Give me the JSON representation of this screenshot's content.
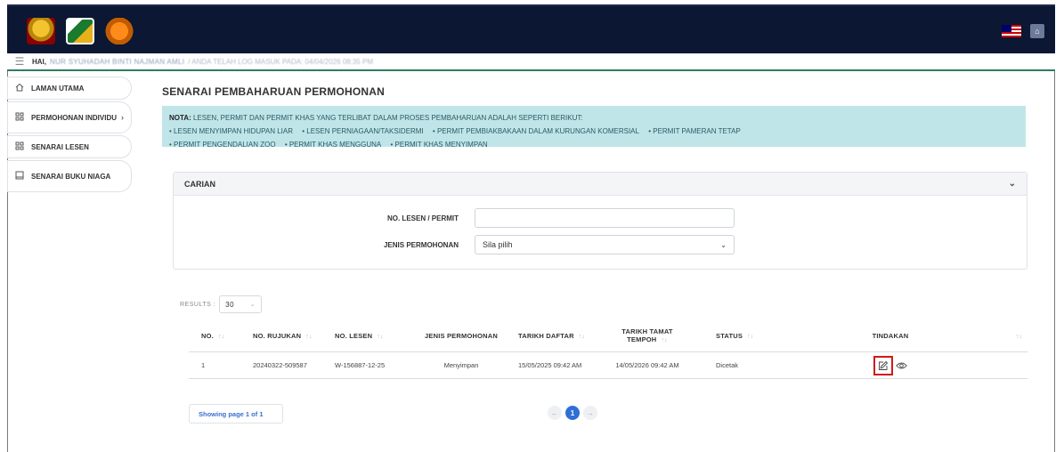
{
  "header": {
    "logos": [
      "crest-logo",
      "perhilitan-logo",
      "tiger-logo"
    ],
    "right_icons": [
      "malaysia-flag-icon",
      "language-icon"
    ]
  },
  "userbar": {
    "greeting": "HAI,",
    "username": "NUR SYUHADAH BINTI NAJMAN AMLI",
    "login_info": "/ ANDA TELAH LOG MASUK PADA: 04/04/2026 08:35 PM"
  },
  "sidebar": {
    "items": [
      {
        "label": "LAMAN UTAMA",
        "icon": "home-icon"
      },
      {
        "label": "PERMOHONAN INDIVIDU",
        "icon": "grid-icon",
        "has_submenu": true
      },
      {
        "label": "SENARAI LESEN",
        "icon": "grid-icon"
      },
      {
        "label": "SENARAI BUKU NIAGA",
        "icon": "book-icon"
      }
    ]
  },
  "main": {
    "title": "SENARAI PEMBAHARUAN PERMOHONAN",
    "note": {
      "prefix": "NOTA:",
      "text": "LESEN, PERMIT DAN PERMIT KHAS YANG TERLIBAT DALAM PROSES PEMBAHARUAN ADALAH SEPERTI BERIKUT:",
      "line1": [
        "LESEN MENYIMPAN HIDUPAN LIAR",
        "LESEN PERNIAGAAN/TAKSIDERMI",
        "PERMIT PEMBIAKBAKAAN DALAM KURUNGAN KOMERSIAL",
        "PERMIT PAMERAN TETAP"
      ],
      "line2": [
        "PERMIT PENGENDALIAN ZOO",
        "PERMIT KHAS MENGGUNA",
        "PERMIT KHAS MENYIMPAN"
      ]
    },
    "search": {
      "title": "CARIAN",
      "license_label": "NO. LESEN / PERMIT",
      "license_value": "",
      "type_label": "JENIS PERMOHONAN",
      "type_value": "Sila pilih"
    },
    "results": {
      "label": "RESULTS :",
      "per_page": "30"
    },
    "table": {
      "headers": {
        "no": "NO.",
        "rujukan": "NO. RUJUKAN",
        "lesen": "NO. LESEN",
        "jenis": "JENIS PERMOHONAN",
        "daftar": "TARIKH DAFTAR",
        "tamat1": "TARIKH TAMAT",
        "tamat2": "TEMPOH",
        "status": "STATUS",
        "tindakan": "TINDAKAN"
      },
      "rows": [
        {
          "no": "1",
          "rujukan": "20240322-509587",
          "lesen": "W-156887-12-25",
          "jenis": "Menyimpan",
          "daftar": "15/05/2025 09:42 AM",
          "tamat": "14/05/2026 09:42 AM",
          "status": "Dicetak"
        }
      ]
    },
    "pagination": {
      "showing": "Showing page 1 of 1",
      "current": "1",
      "prev": "←",
      "next": "→"
    }
  },
  "colors": {
    "topbar": "#0b1733",
    "accent_green": "#2e7d5b",
    "note_bg": "#bfe5e9",
    "highlight_red": "#d11a1a",
    "page_active": "#2f6fd6"
  }
}
